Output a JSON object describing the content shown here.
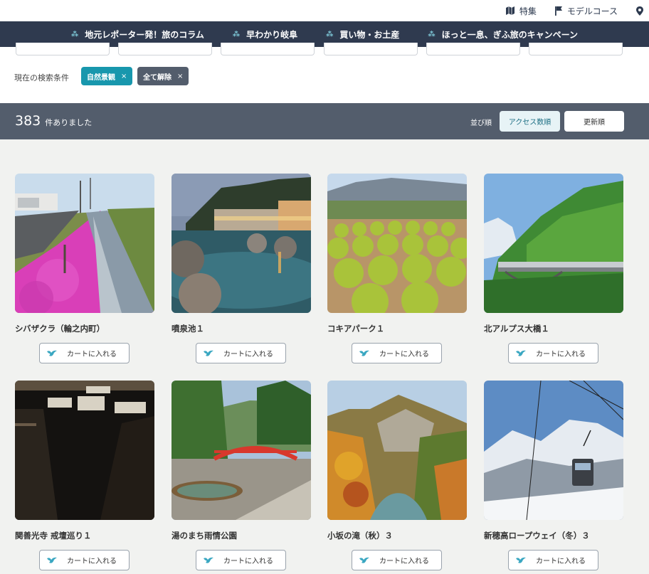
{
  "topbar": {
    "links": [
      {
        "label": "特集",
        "icon": "map-icon"
      },
      {
        "label": "モデルコース",
        "icon": "flag-icon"
      },
      {
        "label": "",
        "icon": "location-pin-icon"
      }
    ]
  },
  "nav": {
    "items": [
      "地元レポーター発！旅のコラム",
      "早わかり岐阜",
      "買い物・お土産",
      "ほっと一息、ぎふ旅のキャンペーン"
    ]
  },
  "filters": {
    "label": "現在の検索条件",
    "chips": [
      {
        "label": "自然景観",
        "close": "×"
      },
      {
        "label": "全て解除",
        "close": "×"
      }
    ]
  },
  "results": {
    "count": "383",
    "count_suffix": "件ありました",
    "sort_label": "並び順",
    "sort_options": [
      "アクセス数順",
      "更新順"
    ]
  },
  "cart_label": "カートに入れる",
  "spots": [
    {
      "name": "シバザクラ（輪之内町）",
      "image": "pink-moss-phlox-field"
    },
    {
      "name": "噴泉池１",
      "image": "hot-spring-pool-at-dusk"
    },
    {
      "name": "コキアパーク１",
      "image": "kochia-park"
    },
    {
      "name": "北アルプス大橋１",
      "image": "bridge-in-green-mountains"
    },
    {
      "name": "関善光寺 戒壇巡り１",
      "image": "dark-temple-stairway"
    },
    {
      "name": "湯のまち雨情公園",
      "image": "park-with-red-bridge"
    },
    {
      "name": "小坂の滝（秋）３",
      "image": "autumn-gorge"
    },
    {
      "name": "新穂高ロープウェイ（冬）３",
      "image": "ropeway-snowy-mountains"
    }
  ],
  "colors": {
    "navy": "#2f3a4f",
    "slate": "#535d6c",
    "teal": "#1897ad"
  }
}
